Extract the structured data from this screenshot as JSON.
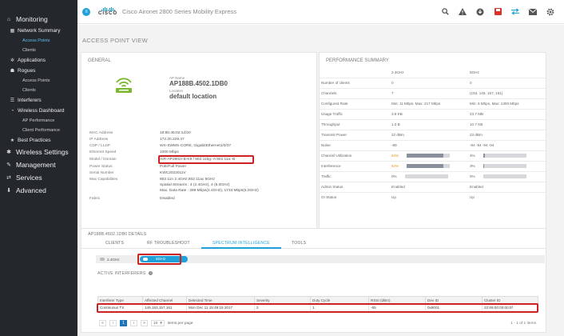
{
  "app": {
    "brand": "CISCO",
    "title": "Cisco Aironet 2800 Series Mobility Express"
  },
  "topbar_icons": [
    "search-icon",
    "warning-icon",
    "download-icon",
    "save-icon",
    "arrows-icon",
    "mail-icon",
    "gear-icon"
  ],
  "sidebar": {
    "items": [
      {
        "label": "Monitoring",
        "icon": "home-icon"
      },
      {
        "label": "Network Summary",
        "icon": "network-icon"
      },
      {
        "label": "Access Points"
      },
      {
        "label": "Clients"
      },
      {
        "label": "Applications",
        "icon": "apps-icon"
      },
      {
        "label": "Rogues",
        "icon": "rogues-icon"
      },
      {
        "label": "Access Points"
      },
      {
        "label": "Clients"
      },
      {
        "label": "Interferers",
        "icon": "interferers-icon"
      },
      {
        "label": "Wireless Dashboard",
        "icon": "dashboard-icon"
      },
      {
        "label": "AP Performance"
      },
      {
        "label": "Client Performance"
      },
      {
        "label": "Best Practices",
        "icon": "star-icon"
      },
      {
        "label": "Wireless Settings",
        "icon": "wifi-icon"
      },
      {
        "label": "Management",
        "icon": "wrench-icon"
      },
      {
        "label": "Services",
        "icon": "services-icon"
      },
      {
        "label": "Advanced",
        "icon": "advanced-icon"
      }
    ]
  },
  "page": {
    "title": "ACCESS POINT VIEW"
  },
  "general": {
    "title": "GENERAL",
    "ap_name_label": "AP Name",
    "ap_name": "AP188B.4502.1DB0",
    "location_label": "Location",
    "location": "default location",
    "rows": [
      {
        "k": "MAC Address",
        "v": "18:8b:45:02:1d:b0"
      },
      {
        "k": "IP Address",
        "v": "172.20.229.47"
      },
      {
        "k": "CDP / LLDP",
        "v": "WS-SWMS-CORE, GigabitEthernet1/0/37"
      },
      {
        "k": "Ethernet Speed",
        "v": "1000 Mbps"
      },
      {
        "k": "Model / Domain",
        "v": "AIR-AP2802I-B-K9 / 802.11bg:-A 802.11a:-B"
      },
      {
        "k": "Power Status",
        "v": "PoE/Full Power"
      },
      {
        "k": "Serial Number",
        "v": "KWC2022011V"
      },
      {
        "k": "Max Capabilities",
        "v": "802.11n 2.4GHz,802.11ac 5GHz\nSpatial Streams : 4 (2.4GHz), 4 (5.0GHz)\nMax. Data Rate : 289 Mbps(2.4GHz), 1733 Mbps(5.0GHz)"
      },
      {
        "k": "Fabric",
        "v": "Disabled"
      }
    ]
  },
  "performance": {
    "title": "PERFORMANCE SUMMARY",
    "col1": "2.4GHz",
    "col2": "5GHz",
    "rows": [
      {
        "label": "Number of clients",
        "v1": "0",
        "v2": "0"
      },
      {
        "label": "Channels",
        "v1": "7",
        "v2": "(153, 149, 157, 161)"
      },
      {
        "label": "Configured Rate",
        "v1": "Min: 11 Mbps, Max: 217 Mbps",
        "v2": "Min: 6 Mbps, Max: 1300 Mbps"
      },
      {
        "label": "Usage Traffic",
        "v1": "3.8 KB",
        "v2": "23.7 MB"
      },
      {
        "label": "Throughput",
        "v1": "1.0 B",
        "v2": "10.7 KB"
      },
      {
        "label": "Transmit Power",
        "v1": "22 dBm",
        "v2": "23 dBm"
      },
      {
        "label": "Noise",
        "v1": "-89",
        "v2": "-94 -94 -94 -94"
      },
      {
        "label": "Channel Utilization",
        "v1": "84%",
        "v2": "4%"
      },
      {
        "label": "Interference",
        "v1": "84%",
        "v2": "3%"
      },
      {
        "label": "Traffic",
        "v1": "0%",
        "v2": "0%"
      },
      {
        "label": "Admin Status",
        "v1": "Enabled",
        "v2": "Enabled"
      },
      {
        "label": "OI Status",
        "v1": "Up",
        "v2": "Up"
      }
    ],
    "bars": {
      "channel_utilization": [
        0.84,
        0.04
      ],
      "interference": [
        0.84,
        0.03
      ],
      "traffic": [
        0.0,
        0.0
      ]
    }
  },
  "details": {
    "title": "AP188B.4502.1DB0 DETAILS",
    "tabs": [
      "CLIENTS",
      "RF TROUBLESHOOT",
      "SPECTRUM INTELLIGENCE",
      "TOOLS"
    ],
    "band_24": "2.4GHz",
    "band_5": "5GHz",
    "active_interferers_label": "ACTIVE INTERFERERS",
    "table": {
      "headers": [
        "Interferer Type",
        "Affected Channel",
        "Detected Time",
        "Severity",
        "Duty Cycle",
        "RSSI (dBm)",
        "Dev ID",
        "Cluster ID"
      ],
      "row": [
        "Continuous TX",
        "149,153,157,161",
        "Mon Dec 11 15:49:15 2017",
        "2",
        "1",
        "-65",
        "0x8001",
        "22:69:00:00:00:0f"
      ]
    },
    "pager": {
      "page": "1",
      "per_page": "10",
      "per_page_label": "items per page",
      "range": "1 - 1 of 1 items"
    }
  }
}
